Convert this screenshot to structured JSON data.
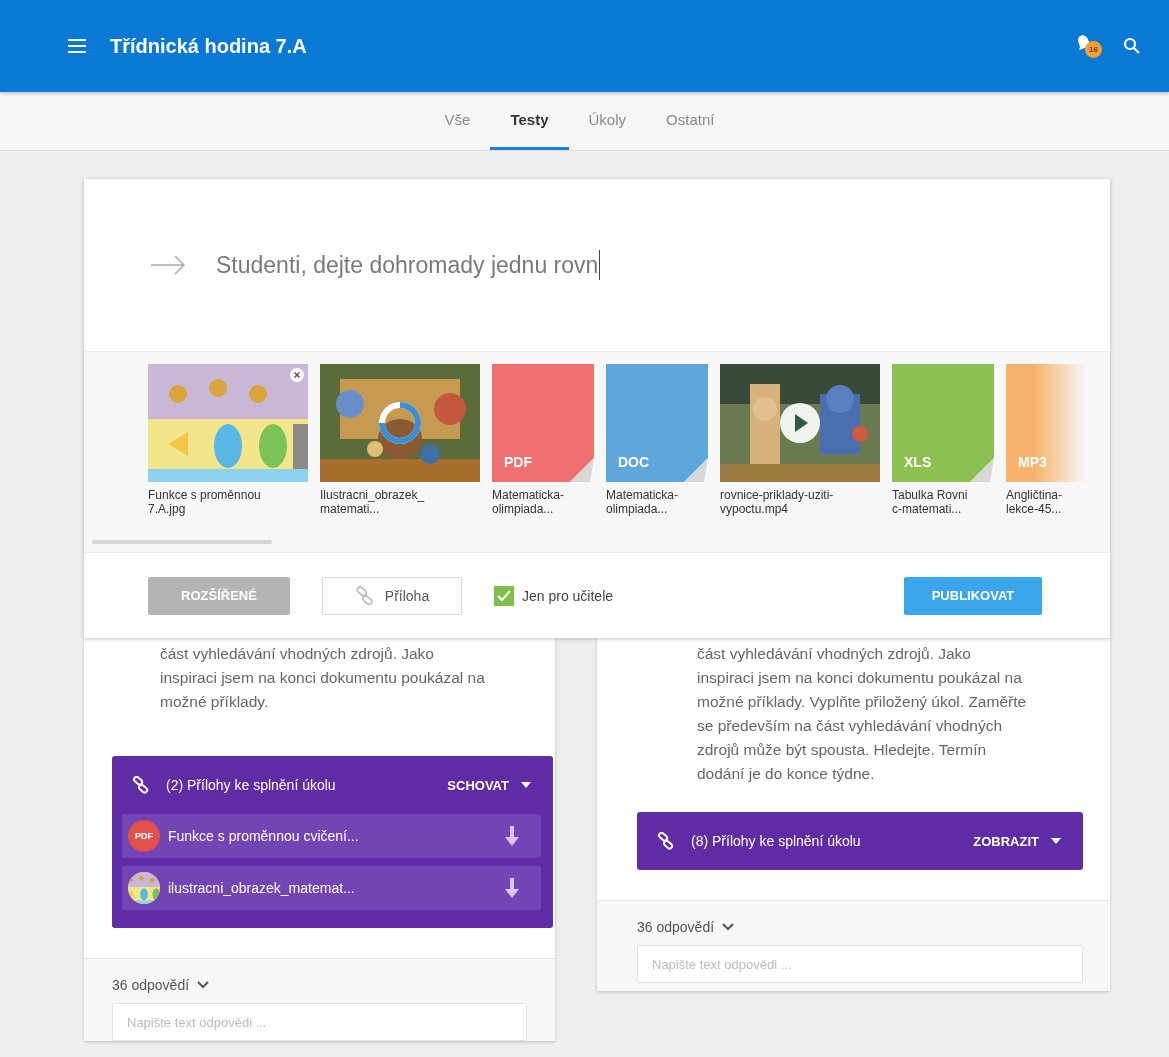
{
  "header": {
    "title": "Třídnická hodina 7.A",
    "notification_count": "16"
  },
  "tabs": [
    {
      "label": "Vše",
      "selected": false
    },
    {
      "label": "Testy",
      "selected": true
    },
    {
      "label": "Úkoly",
      "selected": false
    },
    {
      "label": "Ostatní",
      "selected": false
    }
  ],
  "composer": {
    "value": "Studenti, dejte dohromady jednu rovn",
    "files": [
      {
        "name_lines": [
          "Funkce s proměnnou",
          "7.A.jpg"
        ],
        "removable": true,
        "loading": false
      },
      {
        "name_lines": [
          "Ilustracni_obrazek_",
          "matemati..."
        ],
        "removable": false,
        "loading": true
      },
      {
        "kind": "pdf",
        "label": "PDF",
        "name_lines": [
          "Matematicka-",
          "olimpiada..."
        ],
        "removable": false,
        "loading": false
      },
      {
        "kind": "doc",
        "label": "DOC",
        "name_lines": [
          "Matematicka-",
          "olimpiada..."
        ],
        "removable": false,
        "loading": false
      },
      {
        "kind": "video",
        "name_lines": [
          "rovnice-priklady-uziti-",
          "vypoctu.mp4"
        ],
        "removable": false,
        "loading": false
      },
      {
        "kind": "xls",
        "label": "XLS",
        "name_lines": [
          "Tabulka Rovni",
          "c-matemati..."
        ],
        "removable": false,
        "loading": false
      },
      {
        "kind": "mp3",
        "label": "MP3",
        "name_lines": [
          "Angličtina-",
          "lekce-45..."
        ],
        "removable": false,
        "loading": false
      }
    ],
    "advanced_button": {
      "label": "ROZŠÍŘENÉ",
      "disabled": true
    },
    "attach_button": {
      "label": "Příloha"
    },
    "teacher_only": {
      "label": "Jen pro učitele",
      "checked": true
    },
    "publish_button": {
      "label": "PUBLIKOVAT"
    }
  },
  "posts": [
    {
      "text": "část vyhledávání vhodných zdrojů. Jako\ninspiraci jsem na konci dokumentu poukázal na\nmožné příklady.",
      "attachments": {
        "title": "(2) Přílohy ke splnění úkolu",
        "toggle": "SCHOVAT",
        "expanded": true,
        "items": [
          {
            "kind": "pdf",
            "badge": "PDF",
            "name": "Funkce s proměnnou cvičení..."
          },
          {
            "kind": "picture",
            "name": "ilustracni_obrazek_matemat..."
          }
        ]
      },
      "replies": "36 odpovědí",
      "reply_placeholder": "Napište text odpovědi ..."
    },
    {
      "text": "část vyhledávání vhodných zdrojů. Jako\ninspiraci jsem na konci dokumentu poukázal na\nmožné příklady. Vyplňte přiložený úkol. Zaměřte\nse především na část vyhledávání vhodných\nzdrojů může být spousta. Hledejte. Termín\ndodání je do konce týdne.",
      "attachments": {
        "title": "(8) Přílohy ke splnění úkolu",
        "toggle": "ZOBRAZIT",
        "expanded": false
      },
      "replies": "36 odpovědí",
      "reply_placeholder": "Napište text odpovědi ..."
    }
  ]
}
